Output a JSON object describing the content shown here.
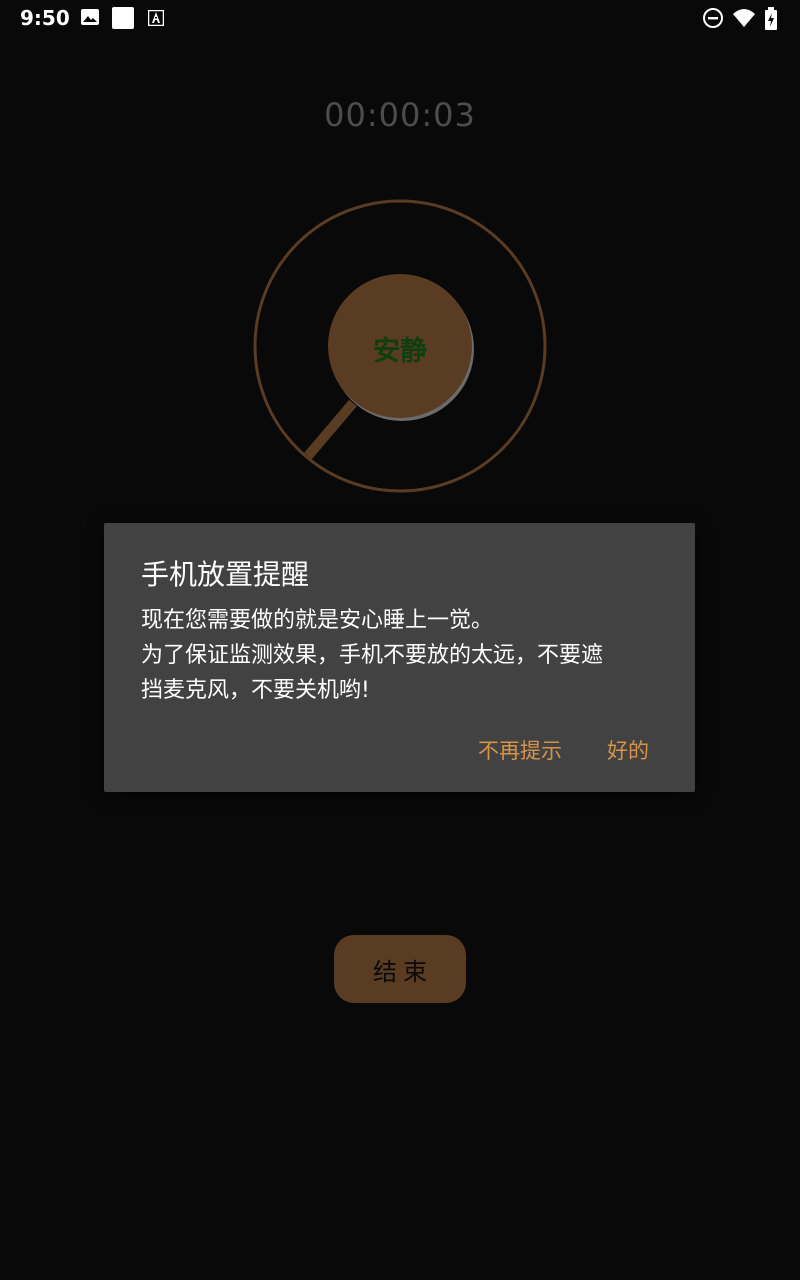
{
  "status_bar": {
    "time": "9:50",
    "icons": [
      "image-icon",
      "square-icon",
      "a-icon",
      "do-not-disturb-icon",
      "wifi-icon",
      "battery-charging-icon"
    ]
  },
  "timer": {
    "value": "00:00:03"
  },
  "dial": {
    "label": "安静",
    "ring_color": "#5a3c22",
    "center_color": "#5a3c22",
    "label_color": "#0f3e0f"
  },
  "dialog": {
    "title": "手机放置提醒",
    "body_lines": [
      "现在您需要做的就是安心睡上一觉。",
      "为了保证监测效果，手机不要放的太远，不要遮",
      "挡麦克风，不要关机哟!"
    ],
    "dont_remind_label": "不再提示",
    "ok_label": "好的",
    "accent_color": "#d8934a",
    "background_color": "#424242"
  },
  "end_button": {
    "label": "结束"
  }
}
